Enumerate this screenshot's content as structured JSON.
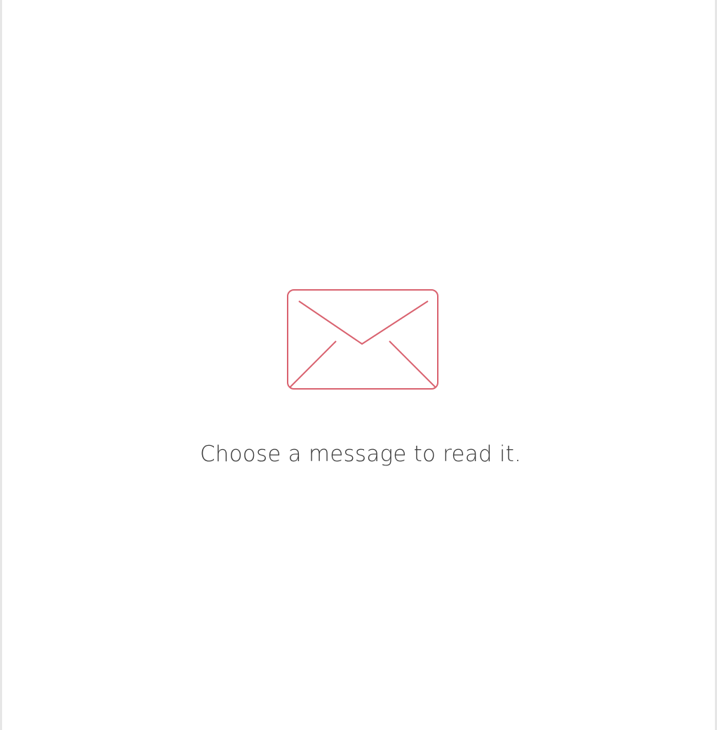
{
  "reading_pane": {
    "empty_state": {
      "icon": "envelope-icon",
      "icon_color": "#d9626f",
      "message": "Choose a message to read it."
    }
  }
}
